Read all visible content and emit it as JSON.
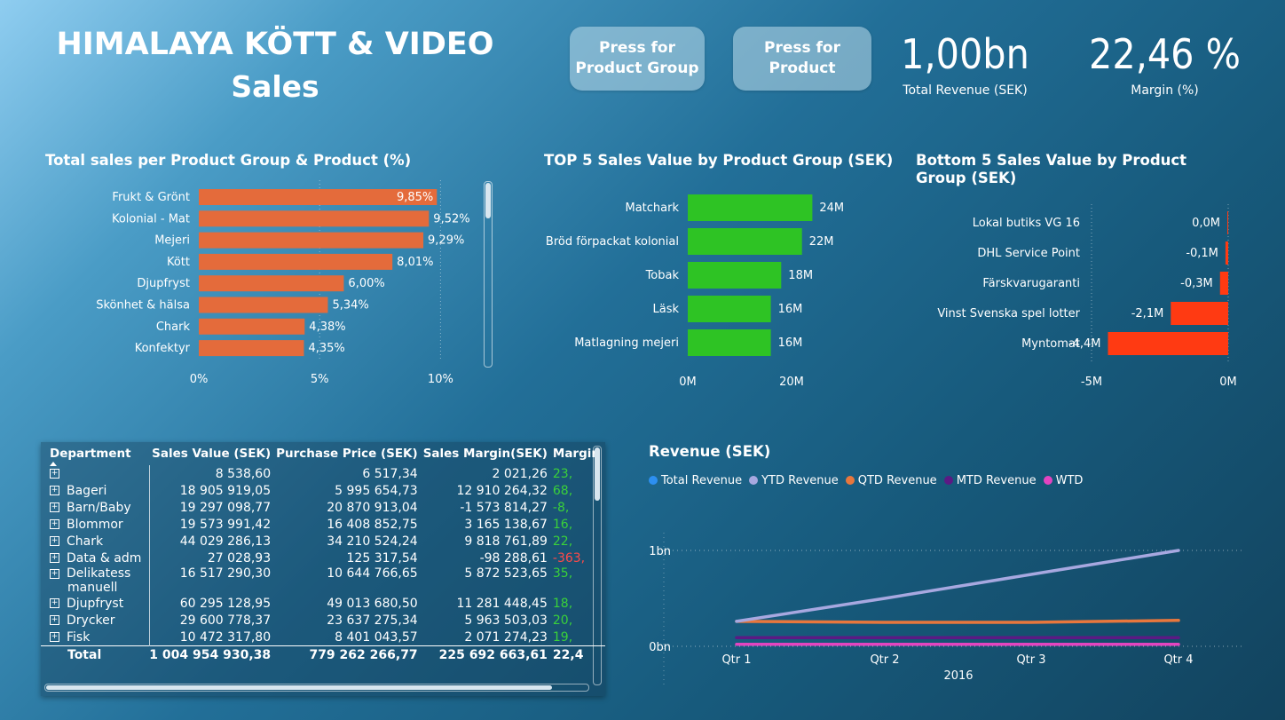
{
  "header": {
    "title_line1": "HIMALAYA KÖTT & VIDEO",
    "title_line2": "Sales",
    "button_product_group_line1": "Press for",
    "button_product_group_line2": "Product Group",
    "button_product_line1": "Press for",
    "button_product_line2": "Product"
  },
  "kpis": {
    "revenue_value": "1,00bn",
    "revenue_label": "Total Revenue (SEK)",
    "margin_value": "22,46 %",
    "margin_label": "Margin (%)"
  },
  "colors": {
    "orange": "#e46b3b",
    "green": "#2ec324",
    "red_orange": "#ff3a12",
    "ytd": "#a7a8e0",
    "qtd": "#e8773d",
    "mtd": "#5b1a84",
    "wtd": "#e344c0",
    "total": "#2d8ff0"
  },
  "chart_data": [
    {
      "type": "bar",
      "orientation": "horizontal",
      "title": "Total sales per Product Group & Product (%)",
      "categories": [
        "Frukt & Grönt",
        "Kolonial - Mat",
        "Mejeri",
        "Kött",
        "Djupfryst",
        "Skönhet & hälsa",
        "Chark",
        "Konfektyr"
      ],
      "values": [
        9.85,
        9.52,
        9.29,
        8.01,
        6.0,
        5.34,
        4.38,
        4.35
      ],
      "labels": [
        "9,85%",
        "9,52%",
        "9,29%",
        "8,01%",
        "6,00%",
        "5,34%",
        "4,38%",
        "4,35%"
      ],
      "xlim": [
        0,
        10.5
      ],
      "ticks": [
        0,
        5,
        10
      ],
      "tick_labels": [
        "0%",
        "5%",
        "10%"
      ]
    },
    {
      "type": "bar",
      "orientation": "horizontal",
      "title": "TOP 5 Sales Value by Product Group (SEK)",
      "categories": [
        "Matchark",
        "Bröd förpackat kolonial",
        "Tobak",
        "Läsk",
        "Matlagning mejeri"
      ],
      "values": [
        24,
        22,
        18,
        16,
        16
      ],
      "labels": [
        "24M",
        "22M",
        "18M",
        "16M",
        "16M"
      ],
      "xlim": [
        0,
        30
      ],
      "ticks": [
        0,
        20
      ],
      "tick_labels": [
        "0M",
        "20M"
      ]
    },
    {
      "type": "bar",
      "orientation": "horizontal",
      "title": "Bottom 5 Sales Value by Product Group (SEK)",
      "categories": [
        "Lokal butiks VG 16",
        "DHL Service Point",
        "Färskvarugaranti",
        "Vinst Svenska spel lotter",
        "Myntomat"
      ],
      "values": [
        0.0,
        -0.1,
        -0.3,
        -2.1,
        -4.4
      ],
      "labels": [
        "0,0M",
        "-0,1M",
        "-0,3M",
        "-2,1M",
        "-4,4M"
      ],
      "xlim": [
        -6.6,
        0
      ],
      "ticks": [
        -5,
        0
      ],
      "tick_labels": [
        "-5M",
        "0M"
      ]
    },
    {
      "type": "line",
      "title": "Revenue (SEK)",
      "x": [
        "Qtr 1",
        "Qtr 2",
        "Qtr 3",
        "Qtr 4"
      ],
      "xlabel": "2016",
      "ylim": [
        0,
        1.0
      ],
      "y_ticks": [
        0,
        1
      ],
      "y_tick_labels": [
        "0bn",
        "1bn"
      ],
      "legend_position": "top-left",
      "series": [
        {
          "name": "Total Revenue",
          "color": "#2d8ff0",
          "values": [
            0.26,
            0.26,
            0.26,
            0.26
          ]
        },
        {
          "name": "YTD Revenue",
          "color": "#a7a8e0",
          "values": [
            0.26,
            0.5,
            0.75,
            1.0
          ]
        },
        {
          "name": "QTD Revenue",
          "color": "#e8773d",
          "values": [
            0.26,
            0.25,
            0.25,
            0.27
          ]
        },
        {
          "name": "MTD Revenue",
          "color": "#5b1a84",
          "values": [
            0.09,
            0.09,
            0.09,
            0.09
          ]
        },
        {
          "name": "WTD",
          "color": "#e344c0",
          "values": [
            0.02,
            0.02,
            0.02,
            0.02
          ]
        }
      ]
    }
  ],
  "table": {
    "headers": [
      "Department",
      "Sales Value (SEK)",
      "Purchase Price (SEK)",
      "Sales Margin(SEK)",
      "Margin"
    ],
    "rows": [
      {
        "dept": "",
        "sales": "8 538,60",
        "purchase": "6 517,34",
        "margin_sek": "2 021,26",
        "margin": "23,",
        "sign": "pos"
      },
      {
        "dept": "Bageri",
        "sales": "18 905 919,05",
        "purchase": "5 995 654,73",
        "margin_sek": "12 910 264,32",
        "margin": "68,",
        "sign": "pos"
      },
      {
        "dept": "Barn/Baby",
        "sales": "19 297 098,77",
        "purchase": "20 870 913,04",
        "margin_sek": "-1 573 814,27",
        "margin": "-8,",
        "sign": "pos"
      },
      {
        "dept": "Blommor",
        "sales": "19 573 991,42",
        "purchase": "16 408 852,75",
        "margin_sek": "3 165 138,67",
        "margin": "16,",
        "sign": "pos"
      },
      {
        "dept": "Chark",
        "sales": "44 029 286,13",
        "purchase": "34 210 524,24",
        "margin_sek": "9 818 761,89",
        "margin": "22,",
        "sign": "pos"
      },
      {
        "dept": "Data & adm",
        "sales": "27 028,93",
        "purchase": "125 317,54",
        "margin_sek": "-98 288,61",
        "margin": "-363,",
        "sign": "neg"
      },
      {
        "dept": "Delikatess",
        "dept2": "manuell",
        "sales": "16 517 290,30",
        "purchase": "10 644 766,65",
        "margin_sek": "5 872 523,65",
        "margin": "35,",
        "sign": "pos"
      },
      {
        "dept": "Djupfryst",
        "sales": "60 295 128,95",
        "purchase": "49 013 680,50",
        "margin_sek": "11 281 448,45",
        "margin": "18,",
        "sign": "pos"
      },
      {
        "dept": "Drycker",
        "sales": "29 600 778,37",
        "purchase": "23 637 275,34",
        "margin_sek": "5 963 503,03",
        "margin": "20,",
        "sign": "pos"
      },
      {
        "dept": "Fisk",
        "sales": "10 472 317,80",
        "purchase": "8 401 043,57",
        "margin_sek": "2 071 274,23",
        "margin": "19,",
        "sign": "pos"
      }
    ],
    "total": {
      "dept": "Total",
      "sales": "1 004 954 930,38",
      "purchase": "779 262 266,77",
      "margin_sek": "225 692 663,61",
      "margin": "22,4"
    }
  }
}
